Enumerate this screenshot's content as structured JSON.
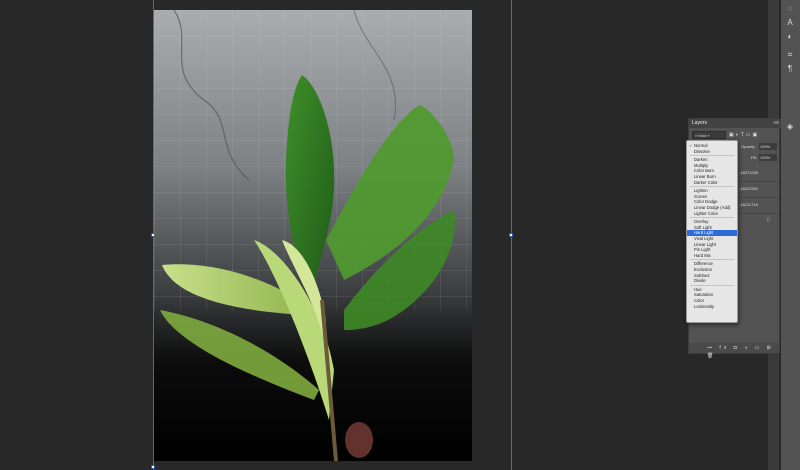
{
  "panel": {
    "title": "Layers",
    "menu_icon": "double-chevron-icon",
    "kind_label": "Kind",
    "opacity_label": "Opacity:",
    "opacity_value": "100%",
    "fill_label": "Fill:",
    "fill_value": "100%",
    "layers": [
      {
        "name": "...18371005"
      },
      {
        "name": "...18222531"
      },
      {
        "name": "...18211716"
      }
    ],
    "footer_icons": "⊶ fx ◘ ◑ ▭ ⊞ 🗑"
  },
  "blend_menu": {
    "groups": [
      [
        "Normal",
        "Dissolve"
      ],
      [
        "Darken",
        "Multiply",
        "Color Burn",
        "Linear Burn",
        "Darker Color"
      ],
      [
        "Lighten",
        "Screen",
        "Color Dodge",
        "Linear Dodge (Add)",
        "Lighter Color"
      ],
      [
        "Overlay",
        "Soft Light",
        "Hard Light",
        "Vivid Light",
        "Linear Light",
        "Pin Light",
        "Hard Mix"
      ],
      [
        "Difference",
        "Exclusion",
        "Subtract",
        "Divide"
      ],
      [
        "Hue",
        "Saturation",
        "Color",
        "Luminosity"
      ]
    ],
    "checked": "Normal",
    "highlighted": "Hard Light"
  },
  "colors": {
    "highlight": "#2f6bd6",
    "workspace": "#282828",
    "panel": "#535353"
  },
  "toolbar": {
    "icons": [
      "lightbulb-icon",
      "text-icon",
      "adjust-icon",
      "crop-icon",
      "paragraph-icon",
      "layers-icon"
    ]
  }
}
